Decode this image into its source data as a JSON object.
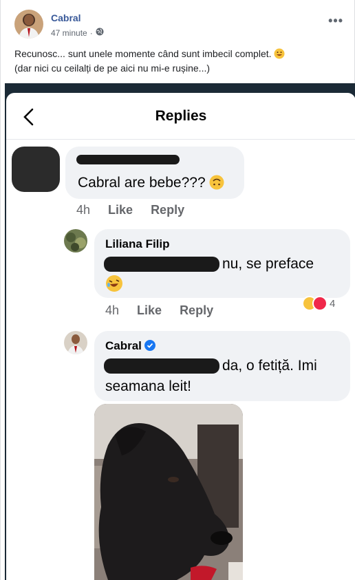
{
  "post": {
    "author": "Cabral",
    "time": "47 minute",
    "separator": "·",
    "more": "•••",
    "text_line1": "Recunosc... sunt unele momente când sunt imbecil complet.",
    "text_line2": "(dar nici cu ceilalți de pe aici nu mi-e rușine...)"
  },
  "replies_screen": {
    "title": "Replies",
    "comments": [
      {
        "name": "",
        "text": "Cabral are bebe???",
        "time": "4h",
        "like": "Like",
        "reply": "Reply"
      },
      {
        "name": "Liliana Filip",
        "text": "nu, se preface",
        "time": "4h",
        "like": "Like",
        "reply": "Reply",
        "reaction_count": "4"
      },
      {
        "name": "Cabral",
        "text_line1": "da, o fetiță. Imi",
        "text_line2": "seamana leit!"
      }
    ]
  },
  "colors": {
    "author_link": "#385898",
    "bubble": "#f0f2f5",
    "verified": "#1877f2",
    "screenshot_frame": "#1b2a36"
  },
  "icons": [
    "globe-icon",
    "more-icon",
    "back-chevron-icon",
    "verified-badge-icon",
    "upside-down-face-emoji",
    "rofl-emoji",
    "haha-reaction-icon",
    "love-reaction-icon"
  ]
}
